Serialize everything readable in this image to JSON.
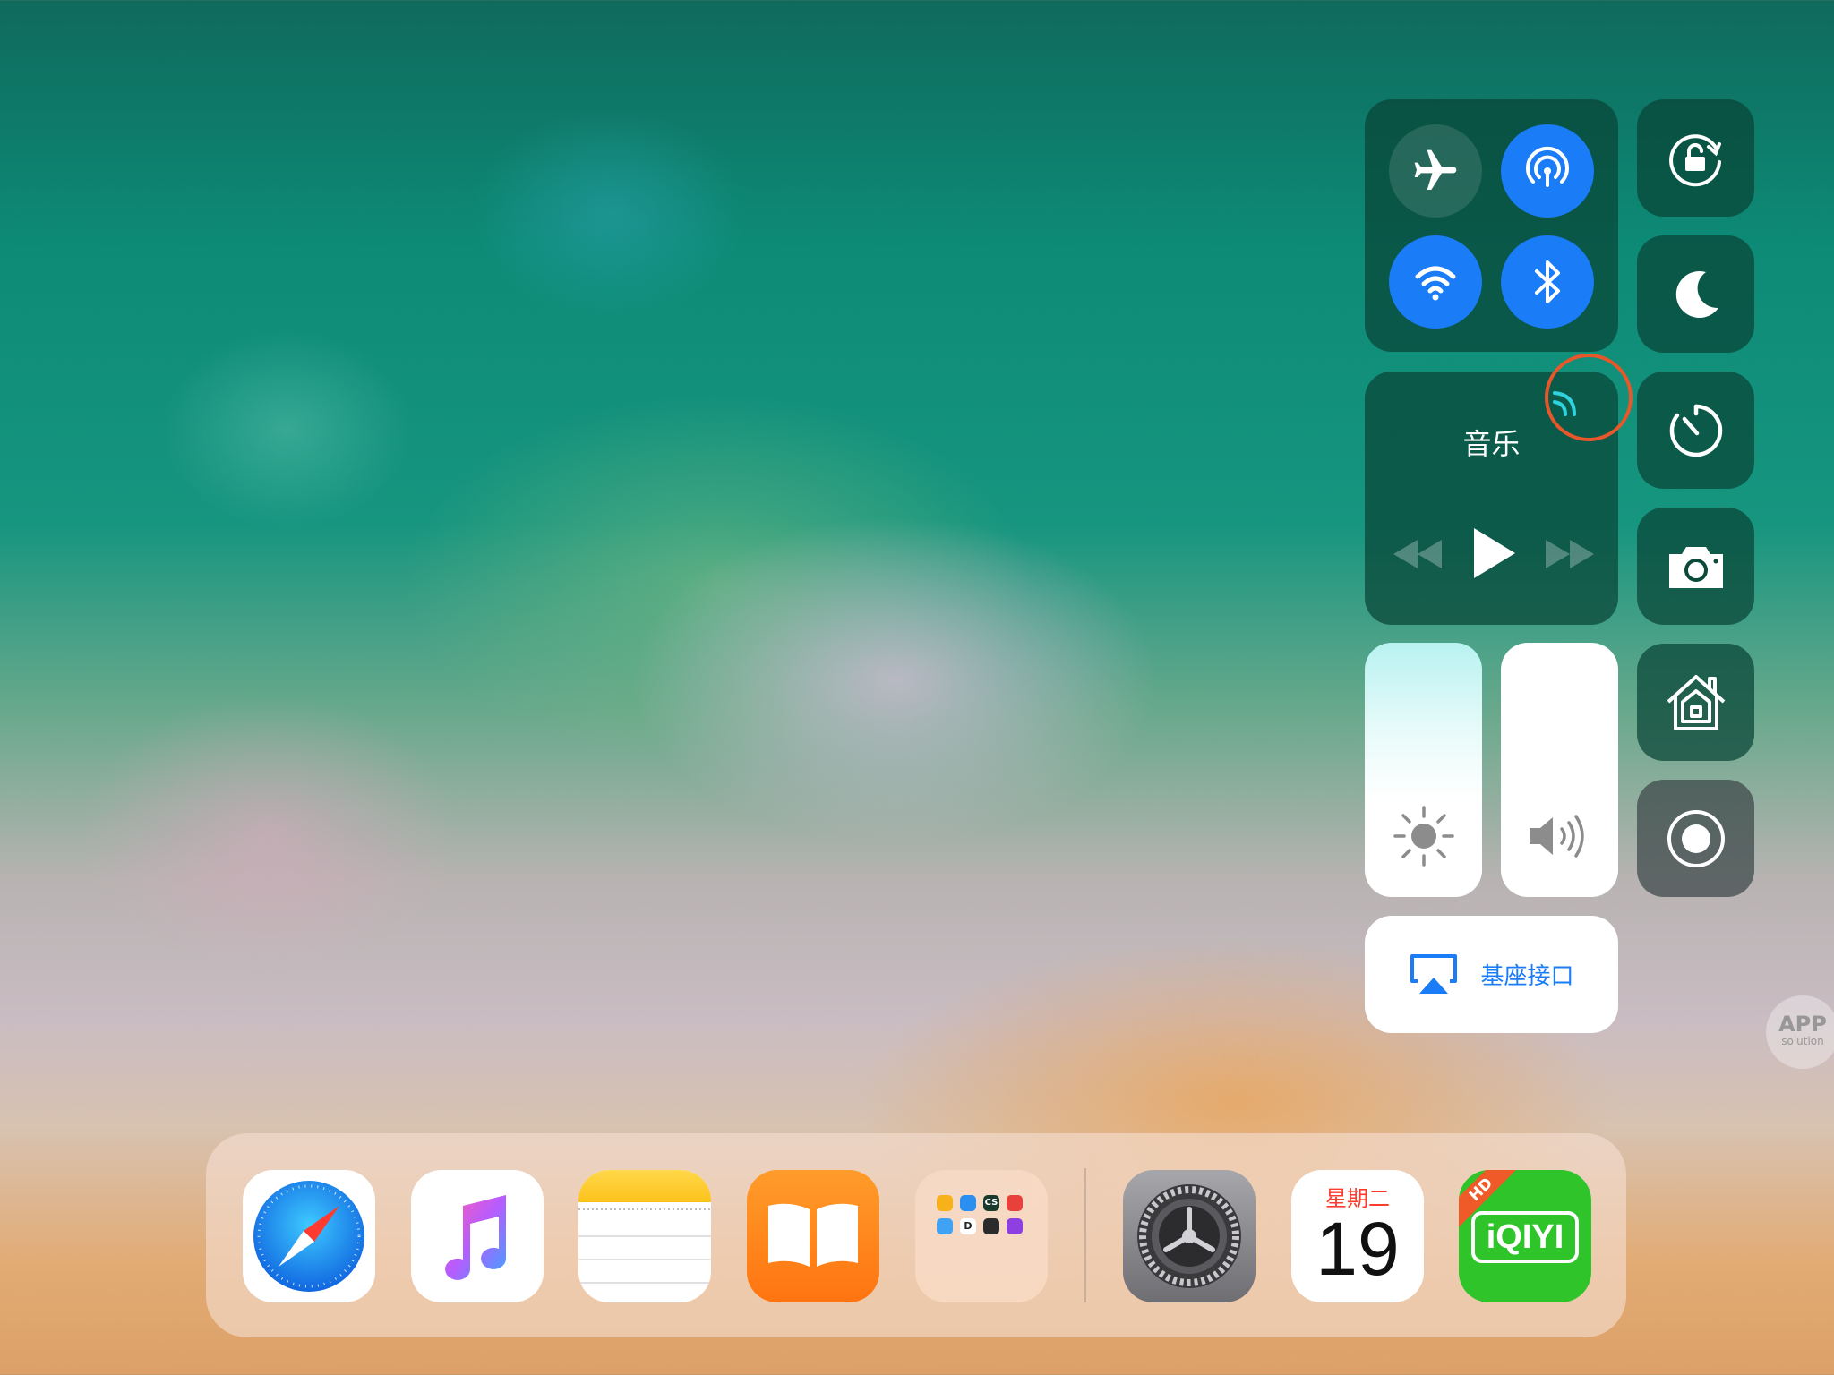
{
  "control_center": {
    "connectivity": [
      {
        "name": "airplane-mode",
        "icon": "airplane-icon",
        "state": "off"
      },
      {
        "name": "airdrop",
        "icon": "airdrop-icon",
        "state": "on"
      },
      {
        "name": "wifi",
        "icon": "wifi-icon",
        "state": "on"
      },
      {
        "name": "bluetooth",
        "icon": "bluetooth-icon",
        "state": "on"
      }
    ],
    "music": {
      "title": "音乐",
      "icons": [
        "airplay-audio-icon",
        "rewind-icon",
        "play-icon",
        "fast-forward-icon"
      ]
    },
    "sliders": {
      "brightness_icon": "sun-icon",
      "volume_icon": "speaker-icon"
    },
    "screen_mirroring": {
      "label": "基座接口",
      "icon": "screen-mirroring-icon"
    },
    "side_toggles": [
      "orientation-lock-icon",
      "moon-icon",
      "timer-icon",
      "camera-icon",
      "home-icon",
      "screen-record-icon"
    ],
    "colors": {
      "active_blue": "#1a7cf6",
      "tile_bg": "#084436",
      "highlight_ring": "#e8572a",
      "airplay_cyan": "#2fd3e0"
    }
  },
  "dock": {
    "apps": [
      "Safari",
      "Music",
      "Notes",
      "Books",
      "Folder",
      "Settings",
      "Calendar",
      "iQIYI HD"
    ],
    "calendar": {
      "weekday": "星期二",
      "day": "19"
    },
    "iqiyi": {
      "logo": "iQIYI",
      "badge": "HD"
    },
    "folder_labels": [
      "CS",
      "D"
    ]
  },
  "watermark": {
    "line1": "APP",
    "line2": "solution"
  }
}
